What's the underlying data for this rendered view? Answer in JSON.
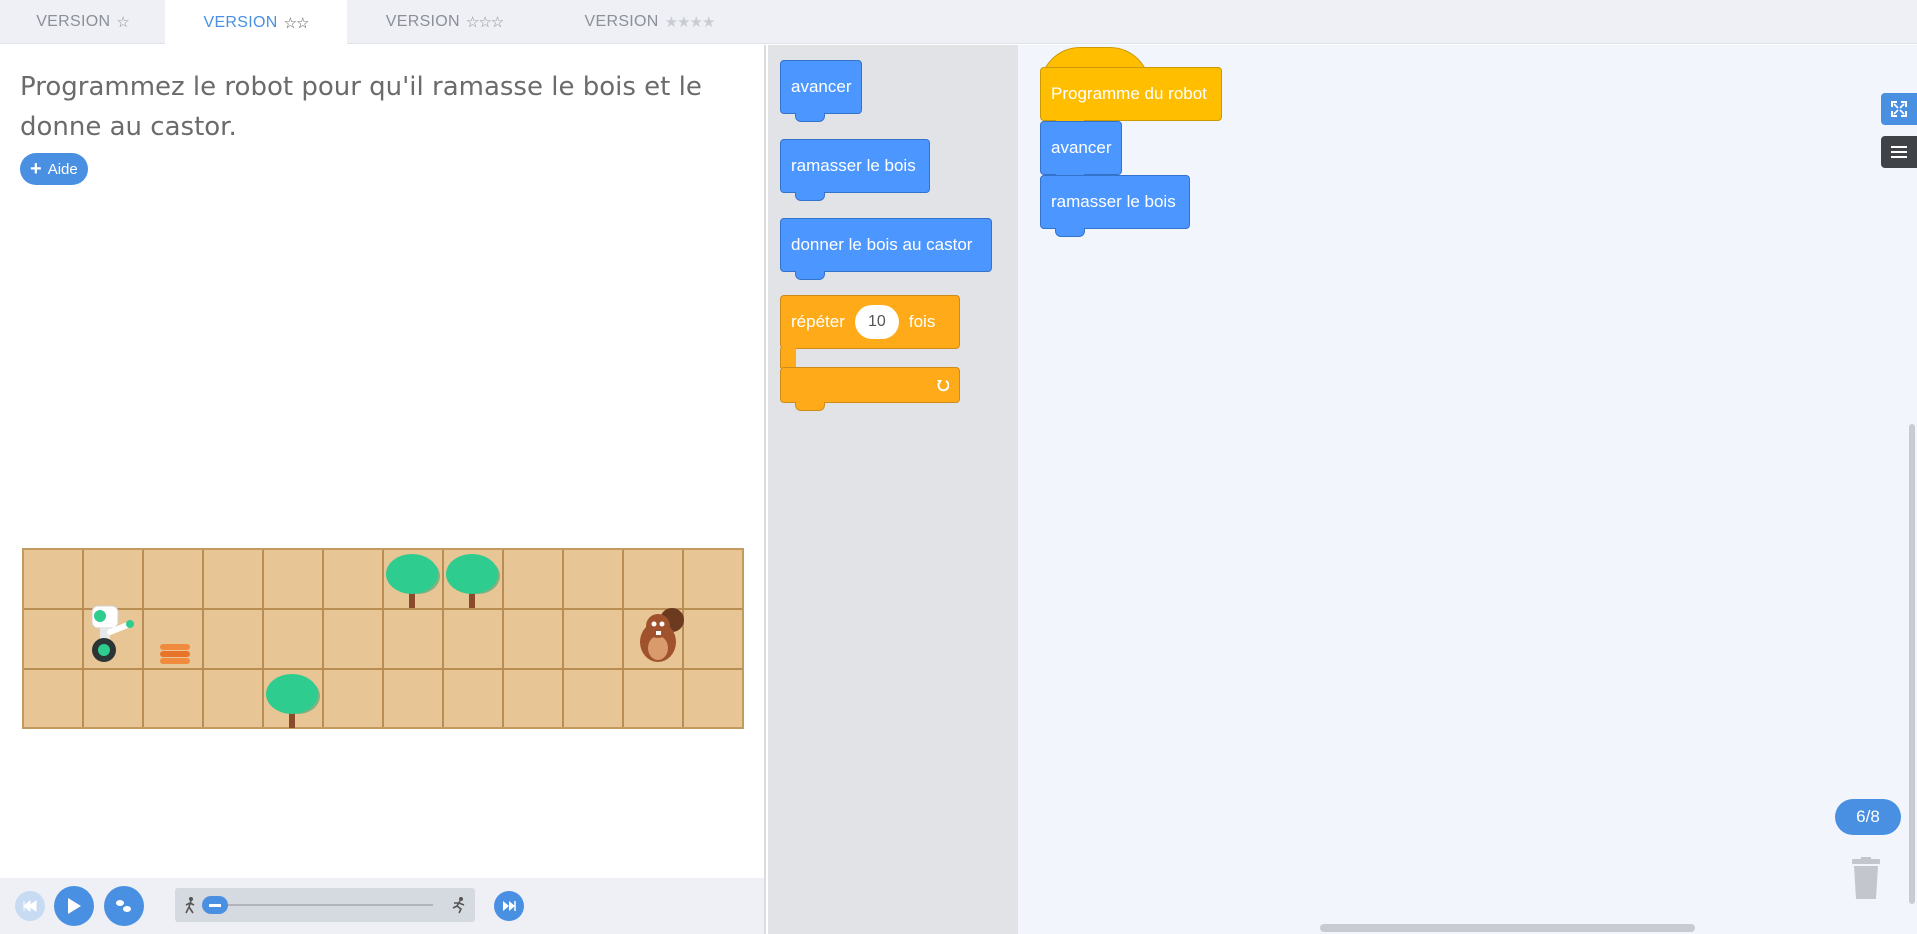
{
  "tabs": [
    {
      "label": "VERSION",
      "stars_on": 1,
      "stars_off": 0,
      "active": false
    },
    {
      "label": "VERSION",
      "stars_on": 2,
      "stars_off": 0,
      "active": true
    },
    {
      "label": "VERSION",
      "stars_on": 3,
      "stars_off": 0,
      "active": false
    },
    {
      "label": "VERSION",
      "stars_on": 0,
      "stars_off": 4,
      "active": false
    }
  ],
  "instructions": "Programmez le robot pour qu'il ramasse le bois et le donne au castor.",
  "help_button": "Aide",
  "toolbox": {
    "blocks": [
      "avancer",
      "ramasser le bois",
      "donner le bois au castor"
    ],
    "repeat": {
      "label_before": "répéter",
      "count": "10",
      "label_after": "fois"
    }
  },
  "workspace": {
    "hat_block": "Programme du robot",
    "program": [
      "avancer",
      "ramasser le bois"
    ]
  },
  "progress": "6/8",
  "grid": {
    "rows": 3,
    "cols": 12
  },
  "colors": {
    "accent": "#4a90e2",
    "motion_block": "#4c97ff",
    "control_block": "#ffab19",
    "hat_block": "#ffbf00",
    "grid_bg": "#e8c595"
  }
}
